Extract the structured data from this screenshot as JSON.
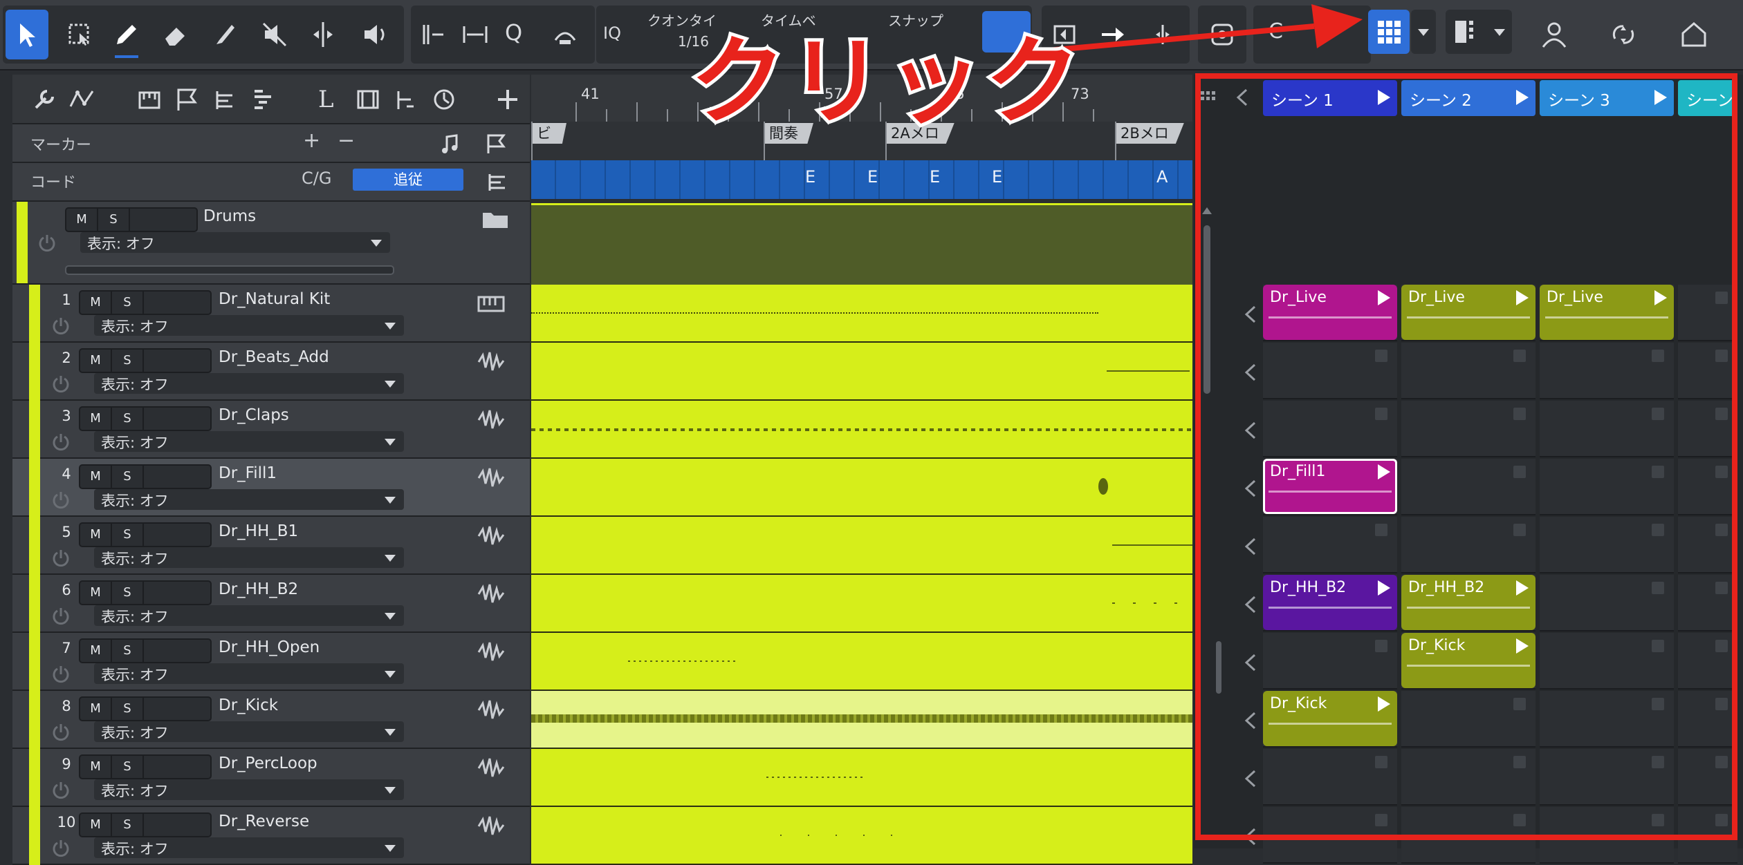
{
  "toolbar": {
    "quantize_label": "クオンタイ",
    "quantize_value": "1/16",
    "timebase_label": "タイムベ",
    "snap_label": "スナップ",
    "iq_label": "IQ",
    "q_label": "Q",
    "c_label": "C",
    "icons": [
      "arrow-tool-icon",
      "range-tool-icon",
      "pencil-tool-icon",
      "eraser-tool-icon",
      "paint-tool-icon",
      "mute-tool-icon",
      "split-tool-icon",
      "listen-tool-icon",
      "audio-bend-icon",
      "timestretch-icon",
      "quantize-icon",
      "auto-punch-icon",
      "scene-grid-icon",
      "user-icon",
      "sync-icon",
      "home-icon"
    ]
  },
  "annotation": {
    "text": "クリック",
    "color": "#e8231c"
  },
  "header_rows": {
    "marker_label": "マーカー",
    "marker_add": "+",
    "marker_remove": "−",
    "chord_label": "コード",
    "chord_key": "C/G",
    "chord_follow": "追従"
  },
  "folder": {
    "name": "Drums",
    "m": "M",
    "s": "S",
    "view": "表示: オフ"
  },
  "tracks": [
    {
      "num": "1",
      "name": "Dr_Natural Kit",
      "view": "表示: オフ",
      "type": "instrument"
    },
    {
      "num": "2",
      "name": "Dr_Beats_Add",
      "view": "表示: オフ",
      "type": "audio"
    },
    {
      "num": "3",
      "name": "Dr_Claps",
      "view": "表示: オフ",
      "type": "audio"
    },
    {
      "num": "4",
      "name": "Dr_Fill1",
      "view": "表示: オフ",
      "type": "audio"
    },
    {
      "num": "5",
      "name": "Dr_HH_B1",
      "view": "表示: オフ",
      "type": "audio"
    },
    {
      "num": "6",
      "name": "Dr_HH_B2",
      "view": "表示: オフ",
      "type": "audio"
    },
    {
      "num": "7",
      "name": "Dr_HH_Open",
      "view": "表示: オフ",
      "type": "audio"
    },
    {
      "num": "8",
      "name": "Dr_Kick",
      "view": "表示: オフ",
      "type": "audio"
    },
    {
      "num": "9",
      "name": "Dr_PercLoop",
      "view": "表示: オフ",
      "type": "audio"
    },
    {
      "num": "10",
      "name": "Dr_Reverse",
      "view": "表示: オフ",
      "type": "audio"
    }
  ],
  "mute_label": "M",
  "solo_label": "S",
  "ruler": {
    "bars": [
      "41",
      "57",
      "65",
      "73"
    ]
  },
  "markers": [
    "ビ",
    "間奏",
    "2Aメロ",
    "2Bメロ"
  ],
  "chords": [
    "E",
    "E",
    "E",
    "E",
    "A"
  ],
  "scenes": [
    {
      "label": "シーン 1",
      "color": "#2a37c9"
    },
    {
      "label": "シーン 2",
      "color": "#2f6fd8"
    },
    {
      "label": "シーン 3",
      "color": "#2a8ad8"
    },
    {
      "label": "シーン",
      "color": "#1fb6c4"
    }
  ],
  "clips": {
    "dr_live_1": "Dr_Live",
    "dr_live_2": "Dr_Live",
    "dr_live_3": "Dr_Live",
    "dr_fill1": "Dr_Fill1",
    "dr_hh_b2_1": "Dr_HH_B2",
    "dr_hh_b2_2": "Dr_HH_B2",
    "dr_kick_2": "Dr_Kick",
    "dr_kick_1": "Dr_Kick"
  },
  "colors": {
    "track_lime": "#d6ee1a",
    "clip_magenta": "#b0158e",
    "clip_olive": "#8c9a16",
    "clip_purple": "#5a16a0",
    "accent_blue": "#2f6fd8"
  }
}
